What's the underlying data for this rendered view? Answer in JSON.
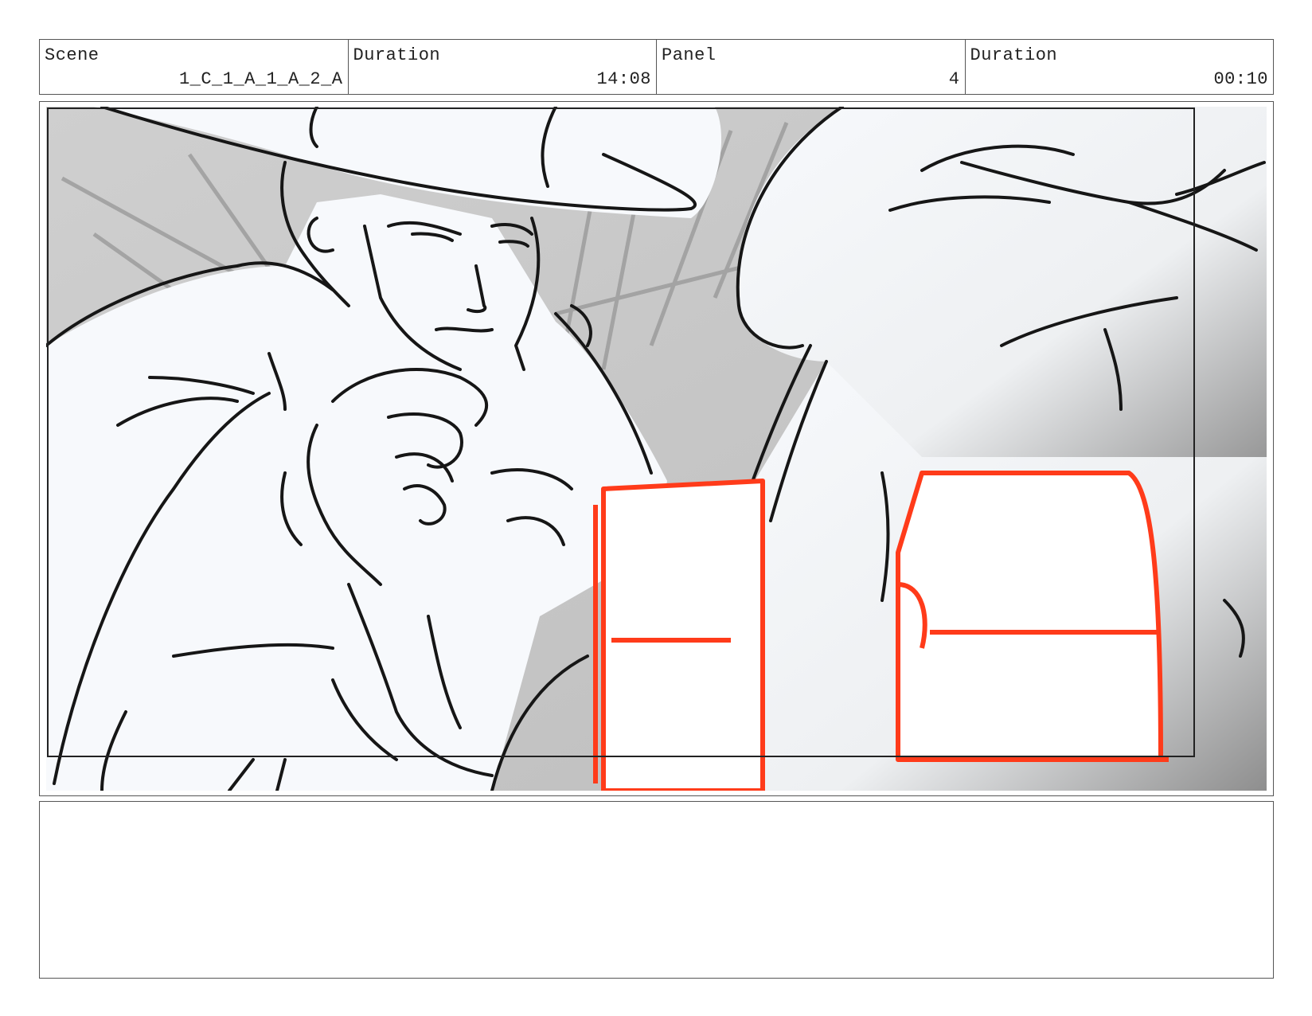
{
  "header": {
    "scene_label": "Scene",
    "scene_value": "1_C_1_A_1_A_2_A",
    "duration_label": "Duration",
    "duration_value": "14:08",
    "panel_label": "Panel",
    "panel_value": "4",
    "panel_duration_label": "Duration",
    "panel_duration_value": "00:10"
  },
  "panel_image": {
    "description_colors": {
      "line": "#1a1a1a",
      "highlight": "#ff3b1a",
      "background": "#c8c8c8",
      "fill": "#f7f9fc"
    }
  },
  "notes": {
    "text": ""
  }
}
